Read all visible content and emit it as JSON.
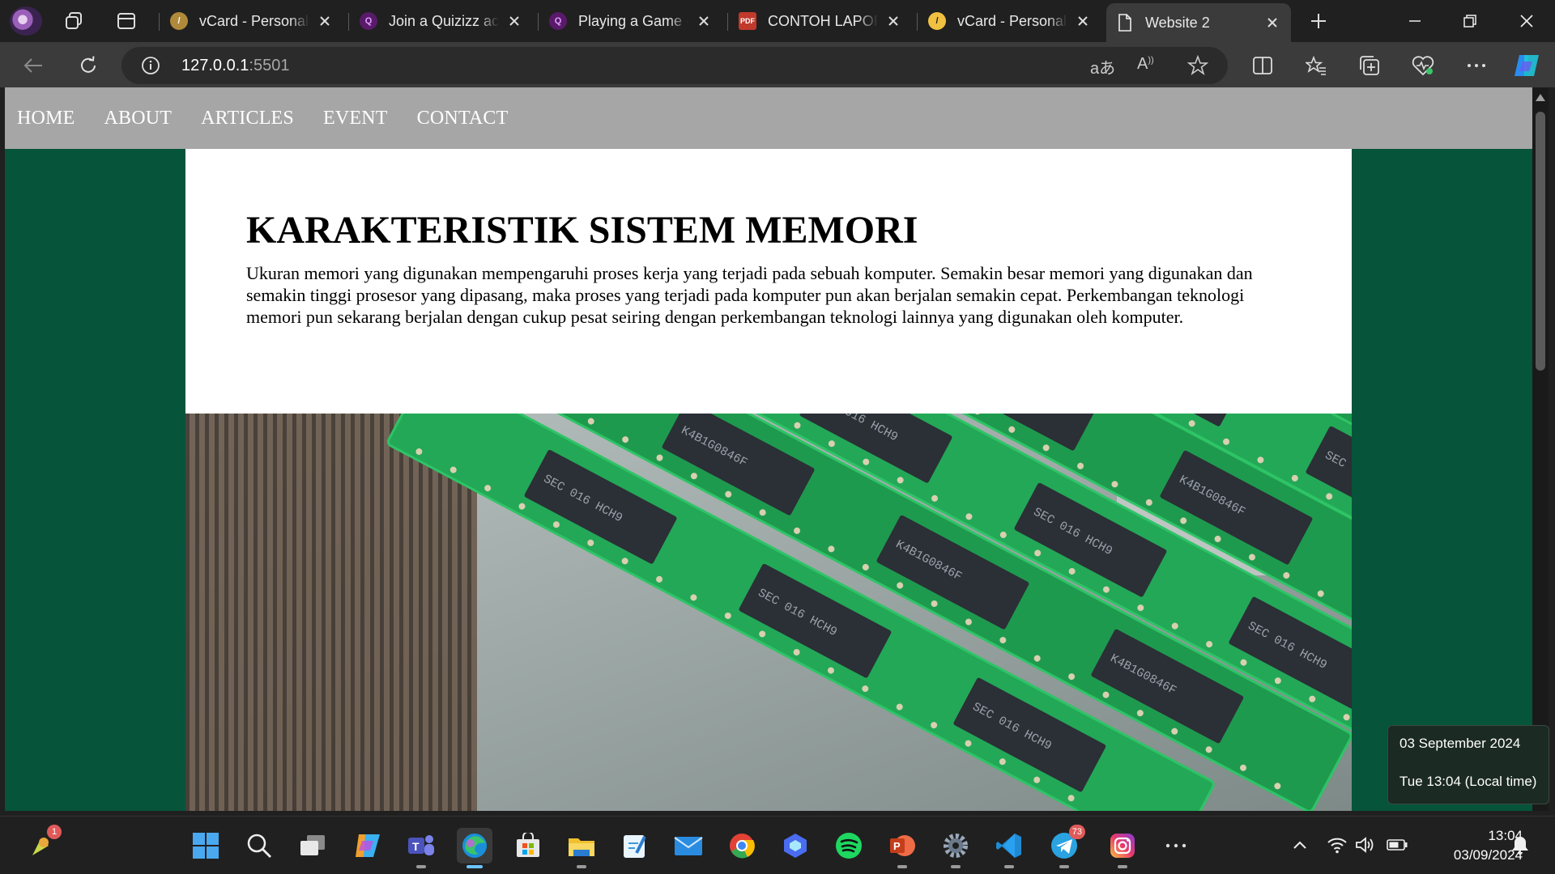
{
  "browser": {
    "tabs": [
      {
        "title": "vCard - Personal Portfolio",
        "favicon": "vcard-icon",
        "color": "#d8b04a"
      },
      {
        "title": "Join a Quizizz activity",
        "favicon": "quizizz-icon",
        "color": "#8a3ab9"
      },
      {
        "title": "Playing a Game - Quizizz",
        "favicon": "quizizz-icon",
        "color": "#8a3ab9"
      },
      {
        "title": "CONTOH LAPORAN",
        "favicon": "pdf-icon",
        "color": "#d04a3a"
      },
      {
        "title": "vCard - Personal Portfolio",
        "favicon": "vcard-icon",
        "color": "#f0c040"
      },
      {
        "title": "Website 2",
        "favicon": "page-icon",
        "color": "#ffffff"
      }
    ],
    "address": {
      "host": "127.0.0.1",
      "port": ":5501"
    }
  },
  "page": {
    "nav": [
      "HOME",
      "ABOUT",
      "ARTICLES",
      "EVENT",
      "CONTACT"
    ],
    "heading": "KARAKTERISTIK SISTEM MEMORI",
    "paragraph": "Ukuran memori yang digunakan mempengaruhi proses kerja yang terjadi pada sebuah komputer. Semakin besar memori yang digunakan dan semakin tinggi prosesor yang dipasang, maka proses yang terjadi pada komputer pun akan berjalan semakin cepat. Perkembangan teknologi memori pun sekarang berjalan dengan cukup pesat seiring dengan perkembangan teknologi lainnya yang digunakan oleh komputer.",
    "image_caption_chips": [
      "SEC 016 HCH9",
      "K4B1G0846F",
      "SEC 016 HCH9",
      "K4B1G0846F",
      "SEC 016 HCH9",
      "K4B1G0"
    ],
    "background_color": "#06543a",
    "nav_color": "#a6a6a6"
  },
  "date_popup": {
    "date": "03 September 2024",
    "time": "Tue 13:04 (Local time)"
  },
  "taskbar": {
    "notification_badge": "1",
    "telegram_badge": "73",
    "clock_time": "13:04",
    "clock_date": "03/09/2024"
  }
}
